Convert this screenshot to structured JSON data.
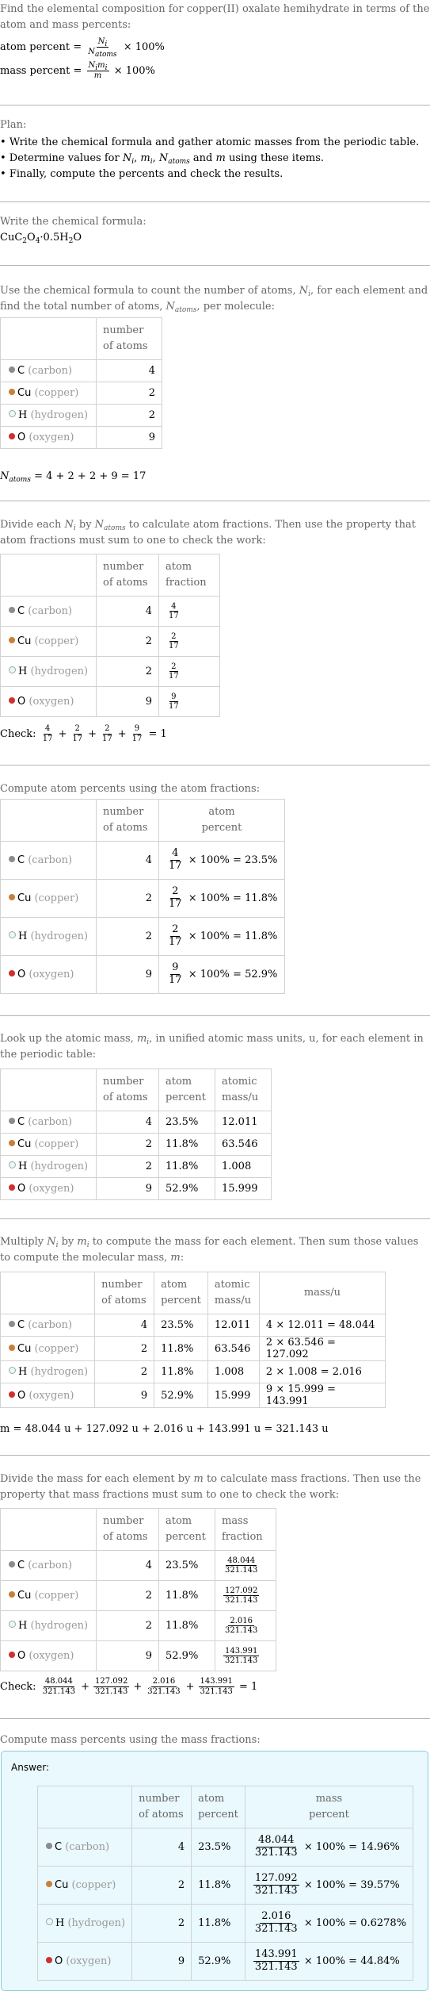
{
  "intro": {
    "question": "Find the elemental composition for copper(II) oxalate hemihydrate in terms of the atom and mass percents:",
    "atom_percent_label": "atom percent",
    "mass_percent_label": "mass percent",
    "times_100": "× 100%"
  },
  "plan": {
    "title": "Plan:",
    "items": [
      "Write the chemical formula and gather atomic masses from the periodic table.",
      "Determine values for N_i, m_i, N_atoms and m using these items.",
      "Finally, compute the percents and check the results."
    ]
  },
  "formula": {
    "title": "Write the chemical formula:",
    "value": "CuC2O4·0.5H2O"
  },
  "elements": [
    {
      "symbol": "C",
      "name": "(carbon)",
      "color": "#8c8c8c",
      "count": "4",
      "fraction_num": "4",
      "atom_percent": "23.5%",
      "atomic_mass": "12.011",
      "mass": "48.044",
      "mass_calc": "4 × 12.011 = 48.044",
      "mass_percent": "14.96%"
    },
    {
      "symbol": "Cu",
      "name": "(copper)",
      "color": "#c8803c",
      "count": "2",
      "fraction_num": "2",
      "atom_percent": "11.8%",
      "atomic_mass": "63.546",
      "mass": "127.092",
      "mass_calc": "2 × 63.546 = 127.092",
      "mass_percent": "39.57%"
    },
    {
      "symbol": "H",
      "name": "(hydrogen)",
      "color": "#e8f8f8",
      "count": "2",
      "fraction_num": "2",
      "atom_percent": "11.8%",
      "atomic_mass": "1.008",
      "mass": "2.016",
      "mass_calc": "2 × 1.008 = 2.016",
      "mass_percent": "0.6278%"
    },
    {
      "symbol": "O",
      "name": "(oxygen)",
      "color": "#d03030",
      "count": "9",
      "fraction_num": "9",
      "atom_percent": "52.9%",
      "atomic_mass": "15.999",
      "mass": "143.991",
      "mass_calc": "9 × 15.999 = 143.991",
      "mass_percent": "44.84%"
    }
  ],
  "headers": {
    "number_of_atoms": [
      "number",
      "of atoms"
    ],
    "atom_fraction": [
      "atom",
      "fraction"
    ],
    "atom_percent": [
      "atom",
      "percent"
    ],
    "atomic_mass": [
      "atomic",
      "mass/u"
    ],
    "mass": "mass/u",
    "mass_fraction": [
      "mass",
      "fraction"
    ],
    "mass_percent": [
      "mass",
      "percent"
    ]
  },
  "step_count": {
    "text": "Use the chemical formula to count the number of atoms, N_i, for each element and find the total number of atoms, N_atoms, per molecule:",
    "result": "= 4 + 2 + 2 + 9 = 17"
  },
  "step_fraction": {
    "text": "Divide each N_i by N_atoms to calculate atom fractions. Then use the property that atom fractions must sum to one to check the work:",
    "check_label": "Check:",
    "check_result": "= 1",
    "denominator": "17"
  },
  "step_atom_percent": {
    "text": "Compute atom percents using the atom fractions:"
  },
  "step_lookup": {
    "text": "Look up the atomic mass, m_i, in unified atomic mass units, u, for each element in the periodic table:"
  },
  "step_multiply": {
    "text": "Multiply N_i by m_i to compute the mass for each element. Then sum those values to compute the molecular mass, m:",
    "result": "m = 48.044 u + 127.092 u + 2.016 u + 143.991 u = 321.143 u"
  },
  "step_mass_fraction": {
    "text": "Divide the mass for each element by m to calculate mass fractions. Then use the property that mass fractions must sum to one to check the work:",
    "check_label": "Check:",
    "check_result": "= 1",
    "denominator": "321.143"
  },
  "step_mass_percent": {
    "text": "Compute mass percents using the mass fractions:",
    "answer_label": "Answer:"
  }
}
